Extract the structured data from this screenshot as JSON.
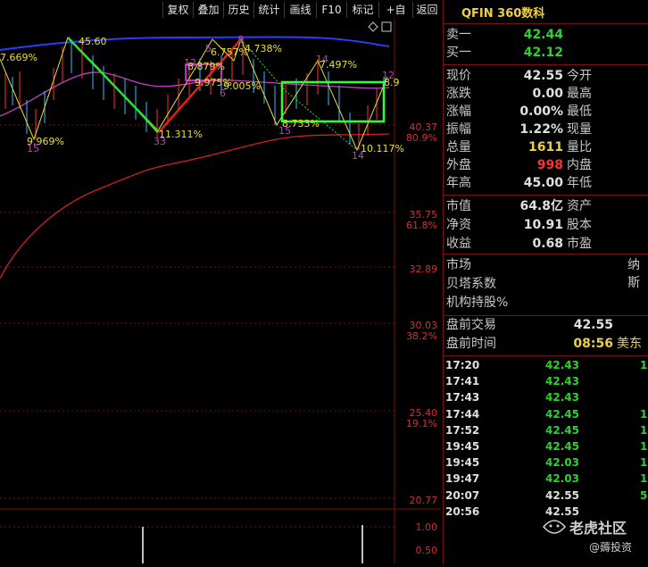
{
  "toolbar": {
    "buttons": [
      "复权",
      "叠加",
      "历史",
      "统计",
      "画线",
      "F10",
      "标记",
      "+自选",
      "返回"
    ]
  },
  "chart": {
    "price_labels": [
      {
        "price": "40.37",
        "pct": "80.9%"
      },
      {
        "price": "35.75",
        "pct": "61.8%"
      },
      {
        "price": "32.89",
        "pct": ""
      },
      {
        "price": "30.03",
        "pct": "38.2%"
      },
      {
        "price": "25.40",
        "pct": "19.1%"
      },
      {
        "price": "20.77",
        "pct": ""
      }
    ],
    "volume_labels": [
      "1.00",
      "0.50"
    ],
    "annotations": [
      {
        "text": "45.60"
      },
      {
        "text": "7.669%"
      },
      {
        "text": "9.969%"
      },
      {
        "text": "15"
      },
      {
        "text": "33"
      },
      {
        "text": "11.311%"
      },
      {
        "text": "12"
      },
      {
        "text": "8.879%"
      },
      {
        "text": "5"
      },
      {
        "text": "6.757%"
      },
      {
        "text": "9.975%"
      },
      {
        "text": "6"
      },
      {
        "text": "9.005%"
      },
      {
        "text": "8"
      },
      {
        "text": "4.738%"
      },
      {
        "text": "14"
      },
      {
        "text": "7.497%"
      },
      {
        "text": "15"
      },
      {
        "text": "8.733%"
      },
      {
        "text": "14"
      },
      {
        "text": "10.117%"
      },
      {
        "text": "12"
      },
      {
        "text": "8.9"
      }
    ],
    "colors": {
      "ma_blue": "#2a3cff",
      "ma_magenta": "#c040c0",
      "ma_red": "#d02020",
      "up": "#ff3030",
      "down": "#30c0ff",
      "rect": "#30ff30"
    }
  },
  "panel": {
    "title": "QFIN 360数科",
    "quote": {
      "sell1": {
        "label": "卖一",
        "value": "42.44"
      },
      "buy1": {
        "label": "买一",
        "value": "42.12"
      }
    },
    "stats": [
      {
        "l1": "现价",
        "v1": "42.55",
        "c1": "#e0e0e0",
        "l2": "今开"
      },
      {
        "l1": "涨跌",
        "v1": "0.00",
        "c1": "#e0e0e0",
        "l2": "最高"
      },
      {
        "l1": "涨幅",
        "v1": "0.00%",
        "c1": "#e0e0e0",
        "l2": "最低"
      },
      {
        "l1": "振幅",
        "v1": "1.22%",
        "c1": "#e0e0e0",
        "l2": "现量"
      },
      {
        "l1": "总量",
        "v1": "1611",
        "c1": "#f0d040",
        "l2": "量比"
      },
      {
        "l1": "外盘",
        "v1": "998",
        "c1": "#ff3030",
        "l2": "内盘"
      },
      {
        "l1": "年高",
        "v1": "45.00",
        "c1": "#e0e0e0",
        "l2": "年低"
      }
    ],
    "fund": [
      {
        "l1": "市值",
        "v1": "64.8亿",
        "l2": "资产"
      },
      {
        "l1": "净资",
        "v1": "10.91",
        "l2": "股本"
      },
      {
        "l1": "收益",
        "v1": "0.68",
        "l2": "市盈"
      }
    ],
    "extra": [
      {
        "label": "市场",
        "value": "纳斯"
      },
      {
        "label": "贝塔系数",
        "value": ""
      },
      {
        "label": "机构持股%",
        "value": ""
      }
    ],
    "premarket": [
      {
        "label": "盘前交易",
        "value": "42.55",
        "color": "#e0e0e0"
      },
      {
        "label": "盘前时间",
        "value": "08:56",
        "color": "#f0d040",
        "suffix": "美东"
      }
    ],
    "ticks": [
      {
        "time": "17:20",
        "price": "42.43",
        "color": "#30d030",
        "vol": "1"
      },
      {
        "time": "17:41",
        "price": "42.43",
        "color": "#30d030",
        "vol": ""
      },
      {
        "time": "17:43",
        "price": "42.43",
        "color": "#30d030",
        "vol": ""
      },
      {
        "time": "17:44",
        "price": "42.45",
        "color": "#30d030",
        "vol": "1"
      },
      {
        "time": "17:52",
        "price": "42.45",
        "color": "#30d030",
        "vol": "1"
      },
      {
        "time": "19:45",
        "price": "42.45",
        "color": "#30d030",
        "vol": "1"
      },
      {
        "time": "19:45",
        "price": "42.03",
        "color": "#30d030",
        "vol": "1"
      },
      {
        "time": "19:47",
        "price": "42.03",
        "color": "#30d030",
        "vol": "1"
      },
      {
        "time": "20:07",
        "price": "42.55",
        "color": "#e0e0e0",
        "vol": "5"
      },
      {
        "time": "20:56",
        "price": "42.55",
        "color": "#e0e0e0",
        "vol": ""
      }
    ]
  },
  "watermark": {
    "main": "老虎社区",
    "sub": "@薅投资"
  }
}
